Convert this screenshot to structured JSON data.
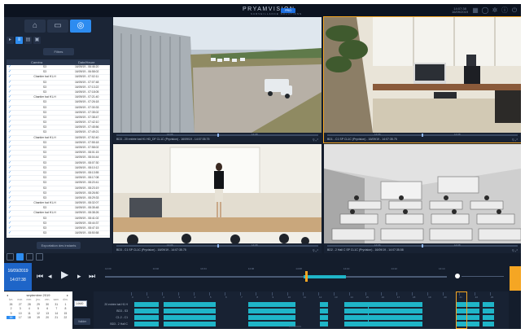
{
  "topbar": {
    "brand": "PRYAMVISION",
    "brand_sub": "SURVEILLANCE SOLUTIONS",
    "edition_badge": "PRO",
    "clock_line1": "14:07:38",
    "clock_line2": "16/09/2019",
    "icons": [
      "grid-icon",
      "user-icon",
      "settings-icon",
      "info-icon",
      "power-icon"
    ]
  },
  "left_panel": {
    "mode_buttons": [
      {
        "icon": "home-icon",
        "glyph": "⌂"
      },
      {
        "icon": "camera-icon",
        "glyph": "▭"
      },
      {
        "icon": "playback-icon",
        "glyph": "◎",
        "active": true
      }
    ],
    "sub_buttons": [
      {
        "icon": "video-icon",
        "glyph": "▸"
      },
      {
        "icon": "list-icon",
        "glyph": "≡",
        "active": true
      },
      {
        "icon": "print-icon",
        "glyph": "▤"
      },
      {
        "icon": "save-icon",
        "glyph": "▣"
      }
    ],
    "filter_label": "Filtres",
    "list_header": {
      "camera": "Caméra",
      "datetime": "Date/Heure"
    },
    "list_rows": [
      {
        "cam": "S3",
        "dt": "16/09/19 - 06:46:20"
      },
      {
        "cam": "S3",
        "dt": "16/09/19 - 06:58:02"
      },
      {
        "cam": "Chantier bat H1-H",
        "dt": "16/09/19 - 07:02:11"
      },
      {
        "cam": "S3",
        "dt": "16/09/19 - 07:07:48"
      },
      {
        "cam": "S3",
        "dt": "16/09/19 - 07:13:22"
      },
      {
        "cam": "S3",
        "dt": "16/09/19 - 07:18:05"
      },
      {
        "cam": "Chantier bat H1-H",
        "dt": "16/09/19 - 07:21:40"
      },
      {
        "cam": "S3",
        "dt": "16/09/19 - 07:26:18"
      },
      {
        "cam": "S3",
        "dt": "16/09/19 - 07:30:33"
      },
      {
        "cam": "S3",
        "dt": "16/09/19 - 07:35:02"
      },
      {
        "cam": "S3",
        "dt": "16/09/19 - 07:38:47"
      },
      {
        "cam": "S3",
        "dt": "16/09/19 - 07:42:10"
      },
      {
        "cam": "S3",
        "dt": "16/09/19 - 07:45:56"
      },
      {
        "cam": "S3",
        "dt": "16/09/19 - 07:49:21"
      },
      {
        "cam": "Chantier bat H1-H",
        "dt": "16/09/19 - 07:52:40"
      },
      {
        "cam": "S3",
        "dt": "16/09/19 - 07:55:18"
      },
      {
        "cam": "S3",
        "dt": "16/09/19 - 07:58:02"
      },
      {
        "cam": "S3",
        "dt": "16/09/19 - 08:01:15"
      },
      {
        "cam": "S3",
        "dt": "16/09/19 - 08:04:44"
      },
      {
        "cam": "S3",
        "dt": "16/09/19 - 08:07:30"
      },
      {
        "cam": "S3",
        "dt": "16/09/19 - 08:10:12"
      },
      {
        "cam": "S3",
        "dt": "16/09/19 - 08:13:55"
      },
      {
        "cam": "S3",
        "dt": "16/09/19 - 08:17:08"
      },
      {
        "cam": "S3",
        "dt": "16/09/19 - 08:20:41"
      },
      {
        "cam": "S3",
        "dt": "16/09/19 - 08:23:19"
      },
      {
        "cam": "S3",
        "dt": "16/09/19 - 08:26:50"
      },
      {
        "cam": "S3",
        "dt": "16/09/19 - 08:29:33"
      },
      {
        "cam": "Chantier bat H1-H",
        "dt": "16/09/19 - 08:32:07"
      },
      {
        "cam": "S3",
        "dt": "16/09/19 - 08:35:48"
      },
      {
        "cam": "Chantier bat H1-H",
        "dt": "16/09/19 - 08:38:26"
      },
      {
        "cam": "S3",
        "dt": "16/09/19 - 08:41:02"
      },
      {
        "cam": "S3",
        "dt": "16/09/19 - 08:44:37"
      },
      {
        "cam": "S3",
        "dt": "16/09/19 - 08:47:15"
      },
      {
        "cam": "S3",
        "dt": "16/09/19 - 08:50:58"
      }
    ],
    "export_label": "Exportation des instants"
  },
  "tiles": [
    {
      "caption": "BD3 - 20 entrée bat H1 HD_DF CL1C (Pryvision) - 16/09/19 - 14:07:35.75",
      "time_a": "14:06",
      "time_b": "14:08",
      "selected": false
    },
    {
      "caption": "BD1 - C1 SP CL1C (Pryvision) - 16/09/19 - 14:07:35.75",
      "time_a": "14:06",
      "time_b": "14:08",
      "selected": true
    },
    {
      "caption": "BD3 - C1 SP CL1C (Pryvision) - 16/09/19 - 14:07:35.75",
      "time_a": "14:06",
      "time_b": "14:08",
      "selected": false
    },
    {
      "caption": "BD2 - 2 Hall C SP CL1C (Pryvision) - 16/09/19 - 14:07:35.58",
      "time_a": "14:06",
      "time_b": "14:08",
      "selected": false
    }
  ],
  "bottom": {
    "date": "16/09/2019",
    "time": "14:07:38",
    "playbar_labels": [
      "14:00",
      "14:02",
      "14:04",
      "14:06",
      "14:08",
      "14:10",
      "14:12",
      "14:14"
    ],
    "controls": [
      {
        "name": "skip-back-icon",
        "glyph": "⏮"
      },
      {
        "name": "step-back-icon",
        "glyph": "◂"
      },
      {
        "name": "play-icon",
        "glyph": "▶"
      },
      {
        "name": "step-forward-icon",
        "glyph": "▸"
      },
      {
        "name": "skip-forward-icon",
        "glyph": "⏭"
      }
    ]
  },
  "calendar": {
    "month": "septembre 2019",
    "weekdays": [
      "lun.",
      "mar.",
      "mer.",
      "jeu.",
      "ven.",
      "sam.",
      "dim."
    ],
    "days": [
      "26",
      "27",
      "28",
      "29",
      "30",
      "31",
      "1",
      "2",
      "3",
      "4",
      "5",
      "6",
      "7",
      "8",
      "9",
      "10",
      "11",
      "12",
      "13",
      "14",
      "15",
      "16",
      "17",
      "18",
      "19",
      "20",
      "21",
      "22"
    ],
    "today": "16",
    "select_value": "14h00",
    "apply_label": "Valider"
  },
  "timeline": {
    "hours": [
      "0",
      "1",
      "2",
      "3",
      "4",
      "5",
      "6",
      "7",
      "8",
      "9",
      "10",
      "11",
      "12",
      "13",
      "14",
      "15",
      "16",
      "17",
      "18",
      "19",
      "20",
      "21",
      "22",
      "23"
    ],
    "rows": [
      {
        "name": "20 entrée bat H1 H"
      },
      {
        "name": "BD3 - S3"
      },
      {
        "name": "C1.2 - C1"
      },
      {
        "name": "BD3 - 2 Hall C"
      }
    ],
    "footer": "16/09/2019"
  },
  "colors": {
    "accent": "#2d8cf0",
    "selection": "#f5a623",
    "recording": "#1fb5c8",
    "panel": "#1b2536"
  }
}
